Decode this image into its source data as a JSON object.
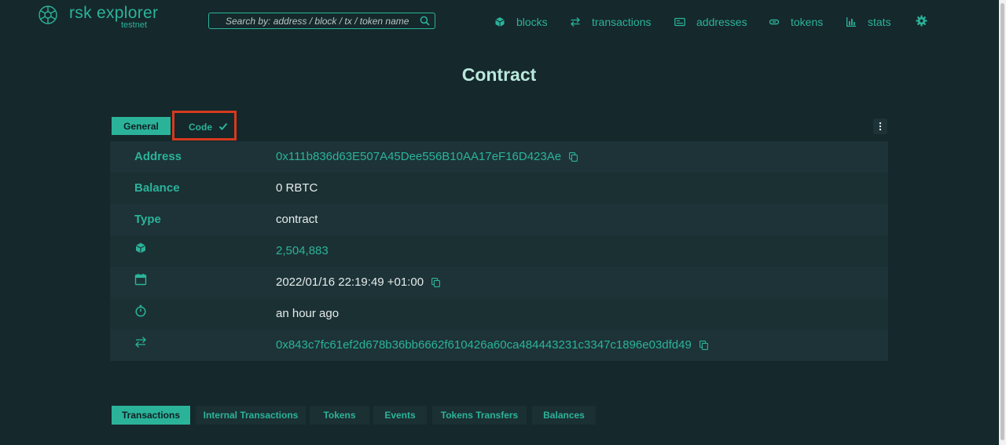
{
  "header": {
    "logo_title": "rsk explorer",
    "logo_sub": "testnet",
    "search_placeholder": "Search by: address / block / tx / token name",
    "nav": [
      {
        "label": "blocks",
        "icon": "cube-icon"
      },
      {
        "label": "transactions",
        "icon": "swap-arrows-icon"
      },
      {
        "label": "addresses",
        "icon": "address-card-icon"
      },
      {
        "label": "tokens",
        "icon": "token-icon"
      },
      {
        "label": "stats",
        "icon": "bar-chart-icon"
      }
    ],
    "settings_icon": "gear-icon"
  },
  "page": {
    "title": "Contract"
  },
  "tabs": {
    "general": "General",
    "code": "Code"
  },
  "details": {
    "address_label": "Address",
    "address_value": "0x111b836d63E507A45Dee556B10AA17eF16D423Ae",
    "balance_label": "Balance",
    "balance_value": "0 RBTC",
    "type_label": "Type",
    "type_value": "contract",
    "block_value": "2,504,883",
    "date_value": "2022/01/16 22:19:49 +01:00",
    "age_value": "an hour ago",
    "tx_value": "0x843c7fc61ef2d678b36bb6662f610426a60ca484443231c3347c1896e03dfd49"
  },
  "bottom_tabs": [
    "Transactions",
    "Internal Transactions",
    "Tokens",
    "Events",
    "Tokens Transfers",
    "Balances"
  ],
  "colors": {
    "background": "#15282b",
    "accent": "#2bb39a",
    "row_odd": "#1d3337",
    "row_even": "#1b3033",
    "highlight_border": "#d63a1f"
  }
}
